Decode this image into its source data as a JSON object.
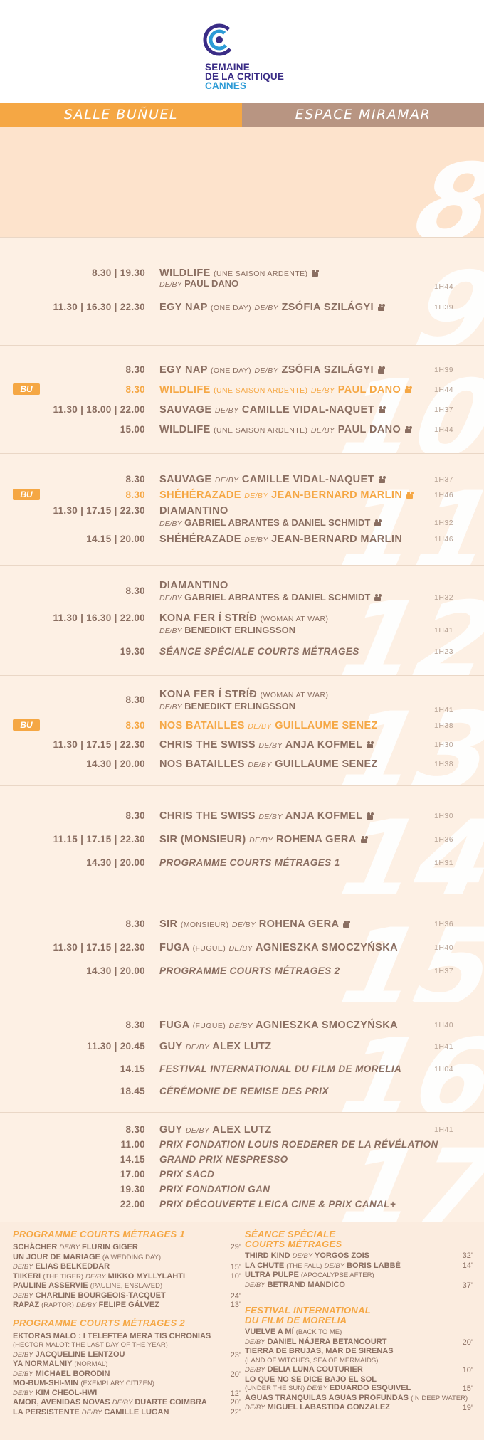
{
  "logo": {
    "line1": "SEMAINE",
    "line2": "DE LA CRITIQUE",
    "line3": "CANNES"
  },
  "tabs": {
    "left": "SALLE BUÑUEL",
    "right": "ESPACE MIRAMAR"
  },
  "colors": {
    "orange": "#f5a744",
    "brown": "#8a6e61",
    "tab_brown": "#b89582"
  },
  "days": [
    {
      "num": "8"
    },
    {
      "num": "9"
    },
    {
      "num": "10"
    },
    {
      "num": "11"
    },
    {
      "num": "12"
    },
    {
      "num": "13"
    },
    {
      "num": "14"
    },
    {
      "num": "15"
    },
    {
      "num": "16"
    },
    {
      "num": "17"
    }
  ],
  "rows": {
    "d9": [
      {
        "times": "8.30 | 19.30",
        "title": "WILDLIFE",
        "sub": "(UNE SAISON ARDENTE)",
        "by": "DE/BY",
        "director": "PAUL DANO",
        "dur": "1H44"
      },
      {
        "times": "11.30 | 16.30 | 22.30",
        "title": "EGY NAP",
        "sub": "(ONE DAY)",
        "by": "DE/BY",
        "director": "ZSÓFIA SZILÁGYI",
        "dur": "1H39"
      }
    ],
    "d10": [
      {
        "times": "8.30",
        "title": "EGY NAP",
        "sub": "(ONE DAY)",
        "by": "DE/BY",
        "director": "ZSÓFIA SZILÁGYI",
        "dur": "1H39"
      },
      {
        "badge": "BU",
        "times": "8.30",
        "title": "WILDLIFE",
        "sub": "(UNE SAISON ARDENTE)",
        "by": "DE/BY",
        "director": "PAUL DANO",
        "dur": "1H44"
      },
      {
        "times": "11.30 | 18.00 | 22.00",
        "title": "SAUVAGE",
        "by": "DE/BY",
        "director": "CAMILLE VIDAL-NAQUET",
        "dur": "1H37"
      },
      {
        "times": "15.00",
        "title": "WILDLIFE",
        "sub": "(UNE SAISON ARDENTE)",
        "by": "DE/BY",
        "director": "PAUL DANO",
        "dur": "1H44"
      }
    ],
    "d11": [
      {
        "times": "8.30",
        "title": "SAUVAGE",
        "by": "DE/BY",
        "director": "CAMILLE VIDAL-NAQUET",
        "dur": "1H37"
      },
      {
        "badge": "BU",
        "times": "8.30",
        "title": "SHÉHÉRAZADE",
        "by": "DE/BY",
        "director": "JEAN-BERNARD MARLIN",
        "dur": "1H46"
      },
      {
        "times": "11.30 | 17.15 | 22.30",
        "title": "DIAMANTINO",
        "by": "DE/BY",
        "director": "GABRIEL ABRANTES & DANIEL SCHMIDT",
        "dur": "1H32"
      },
      {
        "times": "14.15 | 20.00",
        "title": "SHÉHÉRAZADE",
        "by": "DE/BY",
        "director": "JEAN-BERNARD MARLIN",
        "dur": "1H46"
      }
    ],
    "d12": [
      {
        "times": "8.30",
        "title": "DIAMANTINO",
        "by": "DE/BY",
        "director": "GABRIEL ABRANTES & DANIEL SCHMIDT",
        "dur": "1H32"
      },
      {
        "times": "11.30 | 16.30 | 22.00",
        "title": "KONA FER Í STRÍÐ",
        "sub": "(WOMAN AT WAR)",
        "by": "DE/BY",
        "director": "BENEDIKT ERLINGSSON",
        "dur": "1H41"
      },
      {
        "times": "19.30",
        "title": "SÉANCE SPÉCIALE COURTS MÉTRAGES",
        "dur": "1H23"
      }
    ],
    "d13": [
      {
        "times": "8.30",
        "title": "KONA FER Í STRÍÐ",
        "sub": "(WOMAN AT WAR)",
        "by": "DE/BY",
        "director": "BENEDIKT ERLINGSSON",
        "dur": "1H41"
      },
      {
        "badge": "BU",
        "times": "8.30",
        "title": "NOS BATAILLES",
        "by": "DE/BY",
        "director": "GUILLAUME SENEZ",
        "dur": "1H38"
      },
      {
        "times": "11.30 | 17.15 | 22.30",
        "title": "CHRIS THE SWISS",
        "by": "DE/BY",
        "director": "ANJA KOFMEL",
        "dur": "1H30"
      },
      {
        "times": "14.30 | 20.00",
        "title": "NOS BATAILLES",
        "by": "DE/BY",
        "director": "GUILLAUME SENEZ",
        "dur": "1H38"
      }
    ],
    "d14": [
      {
        "times": "8.30",
        "title": "CHRIS THE SWISS",
        "by": "DE/BY",
        "director": "ANJA KOFMEL",
        "dur": "1H30"
      },
      {
        "times": "11.15 | 17.15 | 22.30",
        "title": "SIR",
        "sub": "(MONSIEUR)",
        "by": "DE/BY",
        "director": "ROHENA GERA",
        "dur": "1H36"
      },
      {
        "times": "14.30 | 20.00",
        "title": "PROGRAMME COURTS MÉTRAGES 1",
        "dur": "1H31"
      }
    ],
    "d15": [
      {
        "times": "8.30",
        "title": "SIR",
        "sub": "(MONSIEUR)",
        "by": "DE/BY",
        "director": "ROHENA GERA",
        "dur": "1H36"
      },
      {
        "times": "11.30 | 17.15 | 22.30",
        "title": "FUGA",
        "sub": "(FUGUE)",
        "by": "DE/BY",
        "director": "AGNIESZKA SMOCZYŃSKA",
        "dur": "1H40"
      },
      {
        "times": "14.30 | 20.00",
        "title": "PROGRAMME COURTS MÉTRAGES 2",
        "dur": "1H37"
      }
    ],
    "d16": [
      {
        "times": "8.30",
        "title": "FUGA",
        "sub": "(FUGUE)",
        "by": "DE/BY",
        "director": "AGNIESZKA SMOCZYŃSKA",
        "dur": "1H40"
      },
      {
        "times": "11.30 | 20.45",
        "title": "GUY",
        "by": "DE/BY",
        "director": "ALEX LUTZ",
        "dur": "1H41"
      },
      {
        "times": "14.15",
        "title": "FESTIVAL INTERNATIONAL DU FILM DE MORELIA",
        "dur": "1H04"
      },
      {
        "times": "18.45",
        "title": "CÉRÉMONIE DE REMISE DES PRIX"
      }
    ],
    "d17": [
      {
        "times": "8.30",
        "title": "GUY",
        "by": "DE/BY",
        "director": "ALEX LUTZ",
        "dur": "1H41"
      },
      {
        "times": "11.00",
        "title": "PRIX FONDATION LOUIS ROEDERER DE LA RÉVÉLATION"
      },
      {
        "times": "14.15",
        "title": "GRAND PRIX NESPRESSO"
      },
      {
        "times": "17.00",
        "title": "PRIX SACD"
      },
      {
        "times": "19.30",
        "title": "PRIX FONDATION GAN"
      },
      {
        "times": "22.00",
        "title": "PRIX DÉCOUVERTE LEICA CINE & PRIX CANAL+"
      }
    ]
  },
  "footer": {
    "pcm1": {
      "heading": "PROGRAMME COURTS MÉTRAGES 1",
      "items": [
        {
          "title": "SCHÄCHER",
          "by": "DE/BY",
          "director": "FLURIN GIGER",
          "dur": "29'"
        },
        {
          "title": "UN JOUR DE MARIAGE",
          "note": "(A WEDDING DAY)",
          "by": "DE/BY",
          "director": "ELIAS BELKEDDAR",
          "dur": "15'"
        },
        {
          "title": "TIIKERI",
          "note": "(THE TIGER)",
          "by": "DE/BY",
          "director": "MIKKO MYLLYLAHTI",
          "dur": "10'"
        },
        {
          "title": "PAULINE ASSERVIE",
          "note": "(PAULINE, ENSLAVED)",
          "by": "DE/BY",
          "director": "CHARLINE BOURGEOIS-TACQUET",
          "dur": "24'"
        },
        {
          "title": "RAPAZ",
          "note": "(RAPTOR)",
          "by": "DE/BY",
          "director": "FELIPE GÁLVEZ",
          "dur": "13'"
        }
      ]
    },
    "pcm2": {
      "heading": "PROGRAMME COURTS MÉTRAGES 2",
      "items": [
        {
          "title": "EKTORAS MALO : I TELEFTEA MERA TIS CHRONIAS",
          "note": "(HECTOR MALOT: THE LAST DAY OF THE YEAR)",
          "by": "DE/BY",
          "director": "JACQUELINE LENTZOU",
          "dur": "23'"
        },
        {
          "title": "YA NORMALNIY",
          "note": "(NORMAL)",
          "by": "DE/BY",
          "director": "MICHAEL BORODIN",
          "dur": "20'"
        },
        {
          "title": "MO-BUM-SHI-MIN",
          "note": "(EXEMPLARY CITIZEN)",
          "by": "DE/BY",
          "director": "KIM CHEOL-HWI",
          "dur": "12'"
        },
        {
          "title": "AMOR, AVENIDAS NOVAS",
          "by": "DE/BY",
          "director": "DUARTE COIMBRA",
          "dur": "20'"
        },
        {
          "title": "LA PERSISTENTE",
          "by": "DE/BY",
          "director": "CAMILLE LUGAN",
          "dur": "22'"
        }
      ]
    },
    "special": {
      "heading1": "SÉANCE SPÉCIALE",
      "heading2": "COURTS MÉTRAGES",
      "items": [
        {
          "title": "THIRD KIND",
          "by": "DE/BY",
          "director": "YORGOS ZOIS",
          "dur": "32'"
        },
        {
          "title": "LA CHUTE",
          "note": "(THE FALL)",
          "by": "DE/BY",
          "director": "BORIS LABBÉ",
          "dur": "14'"
        },
        {
          "title": "ULTRA PULPE",
          "note": "(APOCALYPSE AFTER)",
          "by": "DE/BY",
          "director": "BETRAND MANDICO",
          "dur": "37'"
        }
      ]
    },
    "morelia": {
      "heading1": "FESTIVAL INTERNATIONAL",
      "heading2": "DU FILM DE MORELIA",
      "items": [
        {
          "title": "VUELVE A MÍ",
          "note": "(BACK TO ME)",
          "by": "DE/BY",
          "director": "DANIEL NÁJERA BETANCOURT",
          "dur": "20'"
        },
        {
          "title": "TIERRA DE BRUJAS, MAR DE SIRENAS",
          "note": "(LAND OF WITCHES, SEA OF MERMAIDS)",
          "by": "DE/BY",
          "director": "DELIA LUNA COUTURIER",
          "dur": "10'"
        },
        {
          "title": "LO QUE NO SE DICE BAJO EL SOL",
          "note": "(UNDER THE SUN)",
          "by": "DE/BY",
          "director": "EDUARDO ESQUIVEL",
          "dur": "15'"
        },
        {
          "title": "AGUAS TRANQUILAS AGUAS PROFUNDAS",
          "note": "(IN DEEP WATER)",
          "by": "DE/BY",
          "director": "MIGUEL LABASTIDA GONZALEZ",
          "dur": "19'"
        }
      ]
    }
  }
}
